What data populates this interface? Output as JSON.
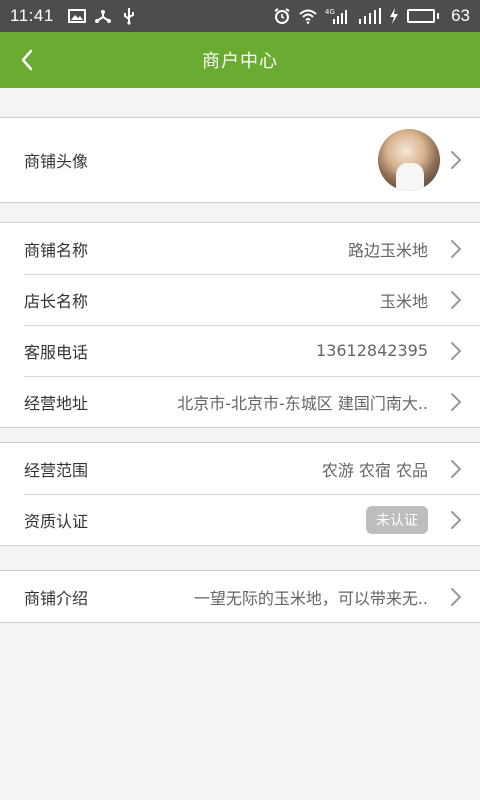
{
  "status_bar": {
    "time": "11:41",
    "battery_level": "63",
    "battery_fraction": 0.63,
    "icons": [
      "image-icon",
      "usb-share-icon",
      "usb-icon",
      "alarm-icon",
      "wifi-icon",
      "signal-4g-icon",
      "signal-icon",
      "charging-icon",
      "battery-icon"
    ]
  },
  "header": {
    "title": "商户中心",
    "back_icon": "chevron-left-icon"
  },
  "colors": {
    "accent": "#6aab32",
    "status_bar": "#4d4d4d",
    "background": "#f5f4f2",
    "badge": "#bdbdbd"
  },
  "groups": [
    {
      "rows": [
        {
          "label": "商铺头像",
          "type": "avatar"
        }
      ]
    },
    {
      "rows": [
        {
          "label": "商铺名称",
          "value": "路边玉米地"
        },
        {
          "label": "店长名称",
          "value": "玉米地"
        },
        {
          "label": "客服电话",
          "value": "13612842395"
        },
        {
          "label": "经营地址",
          "value": "北京市-北京市-东城区 建国门南大.."
        }
      ]
    },
    {
      "rows": [
        {
          "label": "经营范围",
          "value": "农游 农宿 农品"
        },
        {
          "label": "资质认证",
          "badge": "未认证"
        }
      ]
    },
    {
      "rows": [
        {
          "label": "商铺介绍",
          "value": "一望无际的玉米地，可以带来无.."
        }
      ]
    }
  ]
}
